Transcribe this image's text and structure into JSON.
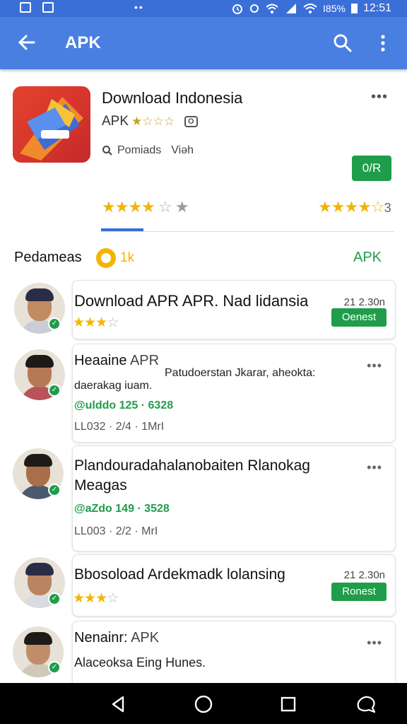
{
  "status_bar": {
    "battery_text": "I85%",
    "time": "12:51",
    "dots": "••"
  },
  "app_bar": {
    "title": "APK",
    "icons": [
      "back-arrow-icon",
      "search-icon",
      "more-vert-icon"
    ]
  },
  "app": {
    "name": "Download Indonesia",
    "sub_label": "APK",
    "sub_stars": "★☆☆☆",
    "sub_tag": "O",
    "meta_label": "Pomiads",
    "meta_label2": "Viəh",
    "more": "•••",
    "open_button": "0/R",
    "rating_stars_filled": "★★★★",
    "rating_stars_outline": "☆",
    "rating_stars_gray": "★",
    "right_stars": "★★★★☆",
    "right_count": "3"
  },
  "section": {
    "title": "Pedameas",
    "count": "1k",
    "link": "APK"
  },
  "cards": [
    {
      "title": "Download APR APR. Nad lidansia",
      "date": "21 2.30n",
      "button": "Oenest",
      "stars": "★★★",
      "stars_outline": "☆"
    },
    {
      "title": "Heaaine",
      "title_suffix": "APR",
      "desc": "daerakag iuam.",
      "center": "Patudoerstan Jkarar, aheokta:",
      "green": "@ulddo 125 · 6328",
      "gray": "LL032 · 2/4 · 1MrI",
      "more": "•••"
    },
    {
      "title": "Plandouradahalanobaiten Rlanokag Meagas",
      "green": "@aZdo 149 · 3528",
      "gray": "LL003 · 2/2 · MrI",
      "more": "•••"
    },
    {
      "title": "Bbosoload Ardekmadk lolansing",
      "date": "21 2.30n",
      "button": "Ronest",
      "stars": "★★★",
      "stars_outline": "☆"
    },
    {
      "title": "Nenainr:",
      "title_suffix": "APK",
      "desc": "Alaceoksa Eing Hunes.",
      "more": "•••"
    }
  ],
  "colors": {
    "appbar": "#4a7fe2",
    "statusbar": "#3a6fd8",
    "green": "#1f9d4a",
    "star": "#f4b400"
  }
}
